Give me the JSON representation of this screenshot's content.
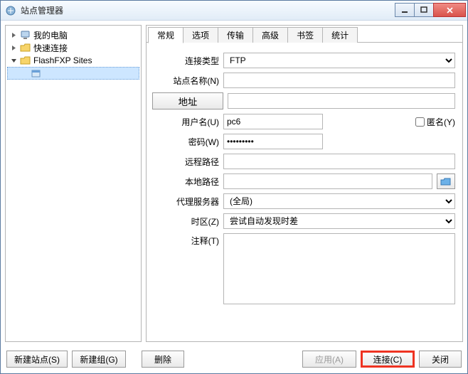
{
  "window": {
    "title": "站点管理器"
  },
  "tree": {
    "items": [
      {
        "label": "我的电脑"
      },
      {
        "label": "快速连接"
      },
      {
        "label": "FlashFXP Sites"
      },
      {
        "label": ""
      }
    ]
  },
  "tabs": {
    "items": [
      {
        "label": "常规"
      },
      {
        "label": "选项"
      },
      {
        "label": "传输"
      },
      {
        "label": "高级"
      },
      {
        "label": "书签"
      },
      {
        "label": "统计"
      }
    ]
  },
  "form": {
    "conn_type_label": "连接类型",
    "conn_type_value": "FTP",
    "site_name_label": "站点名称(N)",
    "site_name_value": "",
    "address_button": "地址",
    "address_value": "",
    "user_label": "用户名(U)",
    "user_value": "pc6",
    "anonymous_label": "匿名(Y)",
    "password_label": "密码(W)",
    "password_value": "•••••••••",
    "remote_path_label": "远程路径",
    "remote_path_value": "",
    "local_path_label": "本地路径",
    "local_path_value": "",
    "proxy_label": "代理服务器",
    "proxy_value": "(全局)",
    "timezone_label": "时区(Z)",
    "timezone_value": "尝试自动发现时差",
    "notes_label": "注释(T)",
    "notes_value": ""
  },
  "footer": {
    "new_site": "新建站点(S)",
    "new_group": "新建组(G)",
    "delete": "删除",
    "apply": "应用(A)",
    "connect": "连接(C)",
    "close": "关闭"
  }
}
